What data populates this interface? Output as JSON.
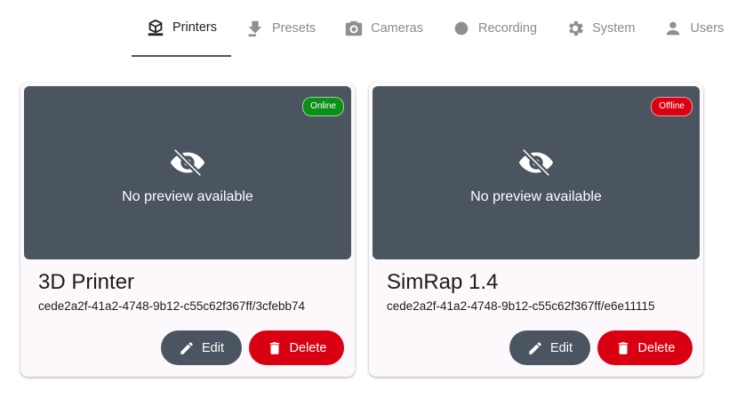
{
  "tabs": [
    {
      "label": "Printers",
      "icon": "printer-icon",
      "active": true
    },
    {
      "label": "Presets",
      "icon": "preset-icon"
    },
    {
      "label": "Cameras",
      "icon": "camera-icon"
    },
    {
      "label": "Recording",
      "icon": "recording-icon"
    },
    {
      "label": "System",
      "icon": "gear-icon"
    },
    {
      "label": "Users",
      "icon": "user-icon"
    }
  ],
  "printers": [
    {
      "name": "3D Printer",
      "uid": "cede2a2f-41a2-4748-9b12-c55c62f367ff/3cfebb74",
      "status": "Online",
      "preview_text": "No preview available",
      "edit_label": "Edit",
      "delete_label": "Delete"
    },
    {
      "name": "SimRap 1.4",
      "uid": "cede2a2f-41a2-4748-9b12-c55c62f367ff/e6e11115",
      "status": "Offline",
      "preview_text": "No preview available",
      "edit_label": "Edit",
      "delete_label": "Delete"
    }
  ],
  "colors": {
    "accent": "#4a5561",
    "online": "#0b8f16",
    "offline": "#d90012",
    "preview_bg": "#4a5560"
  }
}
